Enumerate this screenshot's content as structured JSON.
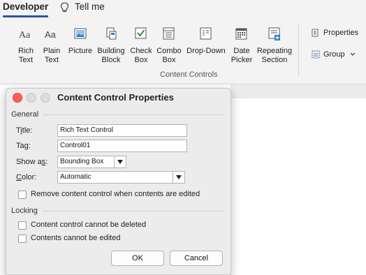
{
  "tabs": {
    "developer": "Developer",
    "tell_me": "Tell me"
  },
  "ribbon": {
    "buttons": [
      {
        "line1": "Rich",
        "line2": "Text",
        "icon": "rich-text-icon"
      },
      {
        "line1": "Plain",
        "line2": "Text",
        "icon": "plain-text-icon"
      },
      {
        "line1": "Picture",
        "line2": "",
        "icon": "picture-icon"
      },
      {
        "line1": "Building",
        "line2": "Block",
        "icon": "building-block-icon"
      },
      {
        "line1": "Check",
        "line2": "Box",
        "icon": "checkbox-icon"
      },
      {
        "line1": "Combo",
        "line2": "Box",
        "icon": "combo-box-icon"
      },
      {
        "line1": "Drop-Down",
        "line2": "",
        "icon": "drop-down-icon"
      },
      {
        "line1": "Date",
        "line2": "Picker",
        "icon": "date-picker-icon"
      },
      {
        "line1": "Repeating",
        "line2": "Section",
        "icon": "repeating-section-icon"
      }
    ],
    "group_label": "Content Controls",
    "properties_label": "Properties",
    "group_menu_label": "Group"
  },
  "dialog": {
    "title": "Content Control Properties",
    "general_section": "General",
    "title_field": {
      "label": "Title:",
      "value": "Rich Text Control"
    },
    "tag_field": {
      "label": "Tag:",
      "value": "Control01"
    },
    "show_as": {
      "label": "Show as:",
      "value": "Bounding Box"
    },
    "color": {
      "label": "Color:",
      "value": "Automatic"
    },
    "remove_when_edited": {
      "label": "Remove content control when contents are edited",
      "checked": false
    },
    "locking_section": "Locking",
    "cannot_be_deleted": {
      "label": "Content control cannot be deleted",
      "checked": false
    },
    "cannot_be_edited": {
      "label": "Contents cannot be edited",
      "checked": false
    },
    "ok_label": "OK",
    "cancel_label": "Cancel"
  },
  "colors": {
    "accent": "#2b579a",
    "close": "#ff5f57"
  }
}
